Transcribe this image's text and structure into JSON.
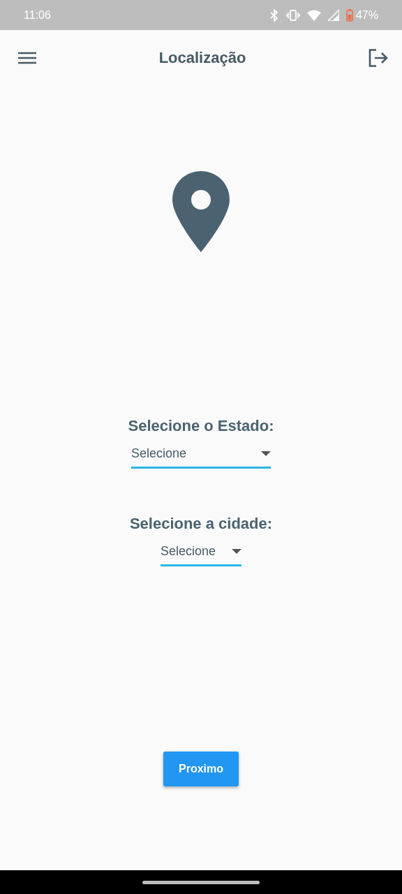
{
  "status_bar": {
    "time": "11:06",
    "battery": "47%"
  },
  "app_bar": {
    "title": "Localização"
  },
  "fields": [
    {
      "label": "Selecione o Estado:",
      "value": "Selecione",
      "kind": "wide"
    },
    {
      "label": "Selecione a cidade:",
      "value": "Selecione",
      "kind": "compact"
    }
  ],
  "button": "Proximo"
}
